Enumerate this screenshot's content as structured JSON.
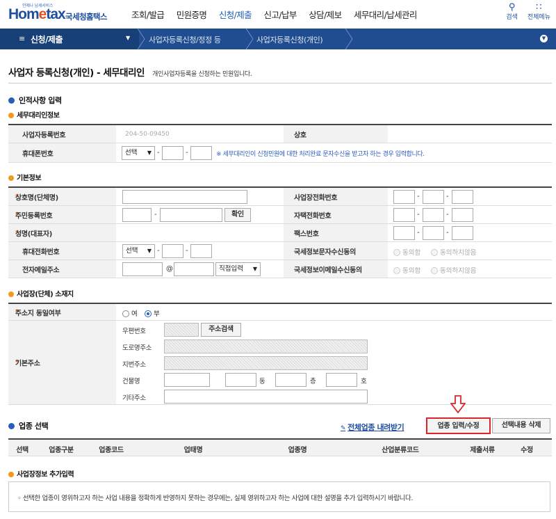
{
  "header": {
    "logo_small": "언제나 납세서비스",
    "logo_home": "Hom",
    "logo_e": "e",
    "logo_tax": "tax",
    "logo_kr": "국세청홈택스",
    "nav": [
      "조회/발급",
      "민원증명",
      "신청/제출",
      "신고/납부",
      "상담/제보",
      "세무대리/납세관리"
    ],
    "active_nav": "신청/제출",
    "search_label": "검색",
    "menu_label": "전체메뉴"
  },
  "breadcrumb": {
    "level1": "신청/제출",
    "level2": "사업자등록신청/정정 등",
    "level3": "사업자등록신청(개인)"
  },
  "page": {
    "title": "사업자 등록신청(개인) - 세무대리인",
    "subtitle": "개인사업자등록을 신청하는 민원입니다."
  },
  "section_personal": {
    "title": "인적사항 입력",
    "agent": {
      "title": "세무대리인정보",
      "biz_no_label": "사업자등록번호",
      "biz_no_value": "204-50-09450",
      "trade_label": "상호",
      "mobile_label": "휴대폰번호",
      "mobile_select": "선택",
      "mobile_note": "※ 세무대리인이 신청민원에 대한 처리완료 문자수신을 받고자 하는 경우 입력합니다."
    },
    "basic": {
      "title": "기본정보",
      "trade_name_label": "상호명(단체명)",
      "resident_no_label": "주민등록번호",
      "confirm_button": "확인",
      "name_label": "성명(대표자)",
      "mobile_label": "휴대전화번호",
      "mobile_select": "선택",
      "email_label": "전자메일주소",
      "email_at": "@",
      "email_domain_select": "직접입력",
      "biz_phone_label": "사업장전화번호",
      "home_phone_label": "자택전화번호",
      "fax_label": "팩스번호",
      "sms_consent_label": "국세정보문자수신동의",
      "email_consent_label": "국세정보이메일수신동의",
      "agree": "동의함",
      "disagree": "동의하지않음"
    },
    "address": {
      "title": "사업장(단체) 소재지",
      "same_label": "주소지 동일여부",
      "yes": "여",
      "no": "부",
      "selected": "부",
      "base_label": "기본주소",
      "zip_label": "우편번호",
      "search_button": "주소검색",
      "road_label": "도로명주소",
      "lot_label": "지번주소",
      "building_label": "건물명",
      "dong": "동",
      "floor": "층",
      "ho": "호",
      "other_label": "기타주소"
    }
  },
  "section_business": {
    "title": "업종 선택",
    "download_link": "전체업종 내려받기",
    "input_button": "업종 입력/수정",
    "delete_button": "선택내용 삭제",
    "columns": [
      "선택",
      "업종구분",
      "업종코드",
      "업태명",
      "업종명",
      "산업분류코드",
      "제출서류",
      "수정"
    ]
  },
  "section_extra": {
    "title": "사업장정보 추가입력",
    "note": "◦ 선택한 업종이 영위하고자 하는 사업 내용을 정확하게 반영하지 못하는 경우에는, 실제 영위하고자 하는 사업에 대한 설명을 추가 입력하시기 바랍니다."
  },
  "colors": {
    "brand": "#1f4fa0",
    "nav_bar": "#1f4d8f",
    "accent": "#e2531f",
    "highlight_border": "#d9262c"
  }
}
